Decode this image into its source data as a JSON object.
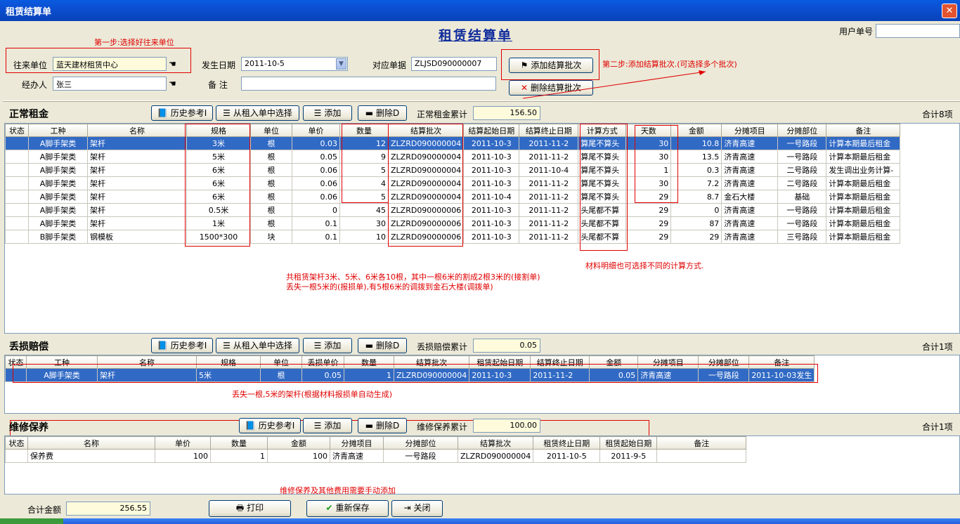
{
  "window": {
    "title": "租赁结算单",
    "close": "✕"
  },
  "form": {
    "heading": "租赁结算单",
    "user_no_label": "用户单号",
    "user_no_value": "",
    "partner_label": "往来单位",
    "partner_value": "蓝天建材租赁中心",
    "date_label": "发生日期",
    "date_value": "2011-10-5",
    "ref_label": "对应单据",
    "ref_value": "ZLJSD090000007",
    "handler_label": "经办人",
    "handler_value": "张三",
    "remark_label": "备 注",
    "remark_value": "",
    "add_batch": "添加结算批次",
    "del_batch": "删除结算批次"
  },
  "notes": {
    "step1": "第一步:选择好往来单位",
    "step2": "第二步:添加结算批次.(可选择多个批次)",
    "rent_1": "共租赁架杆3米、5米、6米各10根，其中一根6米的割成2根3米的(接割单)",
    "rent_2": "丢失一根5米的(报损单),有5根6米的调拨到金石大楼(调拨单)",
    "calc": "材料明细也可选择不同的计算方式.",
    "loss": "丢失一根,5米的架杆(根据材料报损单自动生成)",
    "maint": "维修保养及其他费用需要手动添加"
  },
  "rent": {
    "title": "正常租金",
    "history": "历史参考I",
    "choose": "从租入单中选择",
    "add": "添加",
    "del": "删除D",
    "total_label": "正常租金累计",
    "total_value": "156.50",
    "count": "合计8项",
    "columns": [
      "状态",
      "工种",
      "名称",
      "规格",
      "单位",
      "单价",
      "数量",
      "结算批次",
      "结算起始日期",
      "结算终止日期",
      "计算方式",
      "天数",
      "金额",
      "分摊项目",
      "分摊部位",
      "备注"
    ],
    "rows": [
      [
        "",
        "A脚手架类",
        "架杆",
        "3米",
        "根",
        "0.03",
        "12",
        "ZLZRD090000004",
        "2011-10-3",
        "2011-11-2",
        "算尾不算头",
        "30",
        "10.8",
        "济青高速",
        "一号路段",
        "计算本期最后租金"
      ],
      [
        "",
        "A脚手架类",
        "架杆",
        "5米",
        "根",
        "0.05",
        "9",
        "ZLZRD090000004",
        "2011-10-3",
        "2011-11-2",
        "算尾不算头",
        "30",
        "13.5",
        "济青高速",
        "一号路段",
        "计算本期最后租金"
      ],
      [
        "",
        "A脚手架类",
        "架杆",
        "6米",
        "根",
        "0.06",
        "5",
        "ZLZRD090000004",
        "2011-10-3",
        "2011-10-4",
        "算尾不算头",
        "1",
        "0.3",
        "济青高速",
        "二号路段",
        "发生调出业务计算-"
      ],
      [
        "",
        "A脚手架类",
        "架杆",
        "6米",
        "根",
        "0.06",
        "4",
        "ZLZRD090000004",
        "2011-10-3",
        "2011-11-2",
        "算尾不算头",
        "30",
        "7.2",
        "济青高速",
        "二号路段",
        "计算本期最后租金"
      ],
      [
        "",
        "A脚手架类",
        "架杆",
        "6米",
        "根",
        "0.06",
        "5",
        "ZLZRD090000004",
        "2011-10-4",
        "2011-11-2",
        "算尾不算头",
        "29",
        "8.7",
        "金石大楼",
        "基础",
        "计算本期最后租金"
      ],
      [
        "",
        "A脚手架类",
        "架杆",
        "0.5米",
        "根",
        "0",
        "45",
        "ZLZRD090000006",
        "2011-10-3",
        "2011-11-2",
        "头尾都不算",
        "29",
        "0",
        "济青高速",
        "一号路段",
        "计算本期最后租金"
      ],
      [
        "",
        "A脚手架类",
        "架杆",
        "1米",
        "根",
        "0.1",
        "30",
        "ZLZRD090000006",
        "2011-10-3",
        "2011-11-2",
        "头尾都不算",
        "29",
        "87",
        "济青高速",
        "一号路段",
        "计算本期最后租金"
      ],
      [
        "",
        "B脚手架类",
        "钢模板",
        "1500*300",
        "块",
        "0.1",
        "10",
        "ZLZRD090000006",
        "2011-10-3",
        "2011-11-2",
        "头尾都不算",
        "29",
        "29",
        "济青高速",
        "三号路段",
        "计算本期最后租金"
      ]
    ]
  },
  "loss": {
    "title": "丢损赔偿",
    "history": "历史参考I",
    "choose": "从租入单中选择",
    "add": "添加",
    "del": "删除D",
    "total_label": "丢损赔偿累计",
    "total_value": "0.05",
    "count": "合计1项",
    "columns": [
      "状态",
      "工种",
      "名称",
      "规格",
      "单位",
      "丢损单价",
      "数量",
      "结算批次",
      "租赁起始日期",
      "结算终止日期",
      "金额",
      "分摊项目",
      "分摊部位",
      "备注"
    ],
    "rows": [
      [
        "",
        "A脚手架类",
        "架杆",
        "5米",
        "根",
        "0.05",
        "1",
        "ZLZRD090000004",
        "2011-10-3",
        "2011-11-2",
        "0.05",
        "济青高速",
        "一号路段",
        "2011-10-03发生"
      ]
    ]
  },
  "maint": {
    "title": "维修保养",
    "history": "历史参考I",
    "add": "添加",
    "del": "删除D",
    "total_label": "维修保养累计",
    "total_value": "100.00",
    "count": "合计1项",
    "columns": [
      "状态",
      "名称",
      "单价",
      "数量",
      "金额",
      "分摊项目",
      "分摊部位",
      "结算批次",
      "租赁终止日期",
      "租赁起始日期",
      "备注"
    ],
    "rows": [
      [
        "",
        "保养费",
        "100",
        "1",
        "100",
        "济青高速",
        "一号路段",
        "ZLZRD090000004",
        "2011-10-5",
        "2011-9-5",
        ""
      ]
    ]
  },
  "footer": {
    "total_label": "合计金额",
    "total_value": "256.55",
    "print": "打印",
    "resave": "重新保存",
    "close": "关闭"
  },
  "colors": {
    "selection": "#316ac5",
    "annotation": "#e00000",
    "title_blue": "#0b4fd1"
  }
}
